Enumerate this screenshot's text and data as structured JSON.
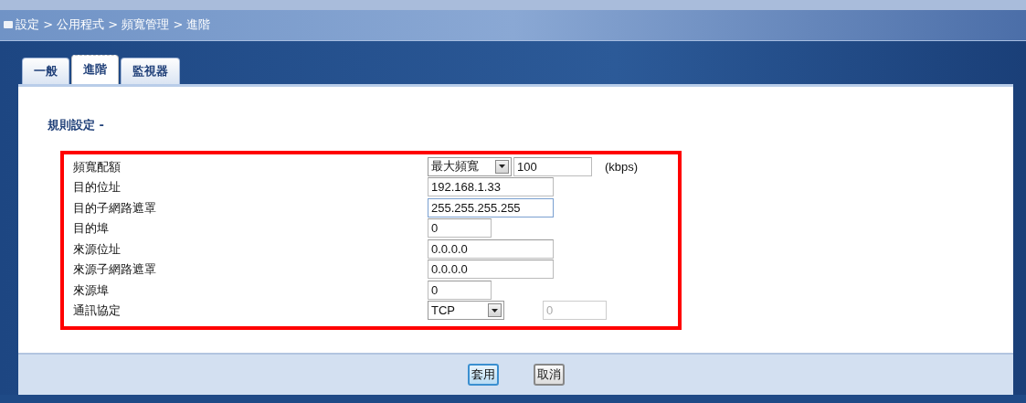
{
  "breadcrumb": "設定 > 公用程式 > 頻寬管理 > 進階",
  "tabs": [
    {
      "label": "一般",
      "selected": false
    },
    {
      "label": "進階",
      "selected": true
    },
    {
      "label": "監視器",
      "selected": false
    }
  ],
  "section_title": "規則設定 -",
  "rows": [
    {
      "kind": "select-input",
      "label": "頻寬配額",
      "select": "最大頻寬",
      "value": "100",
      "unit": "(kbps)"
    },
    {
      "kind": "address",
      "label": "目的位址",
      "value": "192.168.1.33",
      "focused": false
    },
    {
      "kind": "address",
      "label": "目的子網路遮罩",
      "value": "255.255.255.255",
      "focused": true
    },
    {
      "kind": "port",
      "label": "目的埠",
      "value": "0",
      "focused": false
    },
    {
      "kind": "address",
      "label": "來源位址",
      "value": "0.0.0.0",
      "focused": false
    },
    {
      "kind": "address",
      "label": "來源子網路遮罩",
      "value": "0.0.0.0",
      "focused": false
    },
    {
      "kind": "port",
      "label": "來源埠",
      "value": "0",
      "focused": false
    },
    {
      "kind": "select-port",
      "label": "通訊協定",
      "select": "TCP",
      "value": "0",
      "disabled": true
    }
  ],
  "buttons": [
    {
      "label": "套用",
      "primary": true
    },
    {
      "label": "取消",
      "primary": false
    }
  ]
}
